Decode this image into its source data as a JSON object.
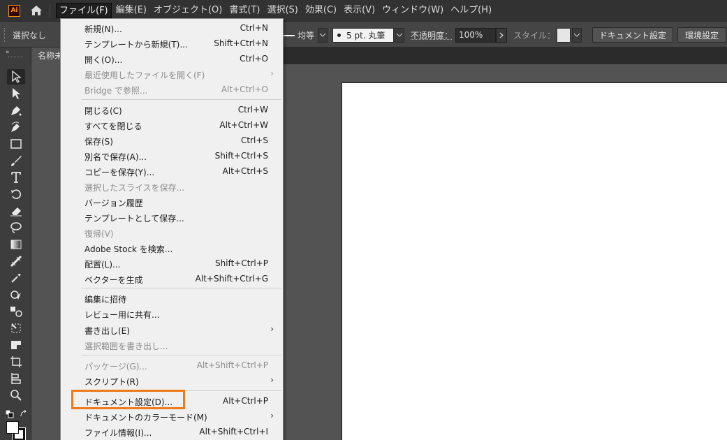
{
  "app": {
    "logo_text": "Ai",
    "accent_color": "#ff9a00",
    "highlight_color": "#f07a1a"
  },
  "menubar": {
    "items": [
      {
        "label": "ファイル(F)",
        "active": true
      },
      {
        "label": "編集(E)"
      },
      {
        "label": "オブジェクト(O)"
      },
      {
        "label": "書式(T)"
      },
      {
        "label": "選択(S)"
      },
      {
        "label": "効果(C)"
      },
      {
        "label": "表示(V)"
      },
      {
        "label": "ウィンドウ(W)"
      },
      {
        "label": "ヘルプ(H)"
      }
    ]
  },
  "controlbar": {
    "selection_text": "選択なし",
    "stroke_profile": "均等",
    "brush": "5 pt. 丸筆",
    "opacity_label": "不透明度：",
    "opacity_value": "100%",
    "style_label": "スタイル：",
    "doc_settings_button": "ドキュメント設定",
    "preferences_button": "環境設定"
  },
  "doc_tab": {
    "title": "名称未"
  },
  "tools": [
    "selection-tool-icon",
    "direct-selection-tool-icon",
    "pen-tool-icon",
    "curvature-tool-icon",
    "rectangle-tool-icon",
    "paintbrush-tool-icon",
    "type-tool-icon",
    "rotate-tool-icon",
    "eraser-tool-icon",
    "lasso-tool-icon",
    "gradient-tool-icon",
    "width-tool-icon",
    "eyedropper-tool-icon",
    "shape-builder-tool-icon",
    "blend-tool-icon",
    "free-transform-tool-icon",
    "graph-tool-icon",
    "artboard-tool-icon",
    "symbol-sprayer-tool-icon",
    "zoom-tool-icon"
  ],
  "file_menu": {
    "items": [
      {
        "label": "新規(N)...",
        "shortcut": "Ctrl+N"
      },
      {
        "label": "テンプレートから新規(T)...",
        "shortcut": "Shift+Ctrl+N"
      },
      {
        "label": "開く(O)...",
        "shortcut": "Ctrl+O"
      },
      {
        "label": "最近使用したファイルを開く(F)",
        "shortcut": "",
        "submenu": true,
        "disabled": true
      },
      {
        "label": "Bridge で参照...",
        "shortcut": "Alt+Ctrl+O",
        "disabled": true
      },
      {
        "label": "閉じる(C)",
        "shortcut": "Ctrl+W"
      },
      {
        "label": "すべてを閉じる",
        "shortcut": "Alt+Ctrl+W"
      },
      {
        "label": "保存(S)",
        "shortcut": "Ctrl+S"
      },
      {
        "label": "別名で保存(A)...",
        "shortcut": "Shift+Ctrl+S"
      },
      {
        "label": "コピーを保存(Y)...",
        "shortcut": "Alt+Ctrl+S"
      },
      {
        "label": "選択したスライスを保存...",
        "shortcut": "",
        "disabled": true
      },
      {
        "label": "バージョン履歴",
        "shortcut": ""
      },
      {
        "label": "テンプレートとして保存...",
        "shortcut": ""
      },
      {
        "label": "復帰(V)",
        "shortcut": "",
        "disabled": true
      },
      {
        "label": "Adobe Stock を検索...",
        "shortcut": ""
      },
      {
        "label": "配置(L)...",
        "shortcut": "Shift+Ctrl+P"
      },
      {
        "label": "ベクターを生成",
        "shortcut": "Alt+Shift+Ctrl+G"
      },
      {
        "label": "編集に招待",
        "shortcut": ""
      },
      {
        "label": "レビュー用に共有...",
        "shortcut": ""
      },
      {
        "label": "書き出し(E)",
        "shortcut": "",
        "submenu": true
      },
      {
        "label": "選択範囲を書き出し...",
        "shortcut": "",
        "disabled": true
      },
      {
        "label": "パッケージ(G)...",
        "shortcut": "Alt+Shift+Ctrl+P",
        "disabled": true
      },
      {
        "label": "スクリプト(R)",
        "shortcut": "",
        "submenu": true
      },
      {
        "label": "ドキュメント設定(D)...",
        "shortcut": "Alt+Ctrl+P",
        "highlighted": true
      },
      {
        "label": "ドキュメントのカラーモード(M)",
        "shortcut": "",
        "submenu": true
      },
      {
        "label": "ファイル情報(I)...",
        "shortcut": "Alt+Shift+Ctrl+I"
      }
    ]
  }
}
